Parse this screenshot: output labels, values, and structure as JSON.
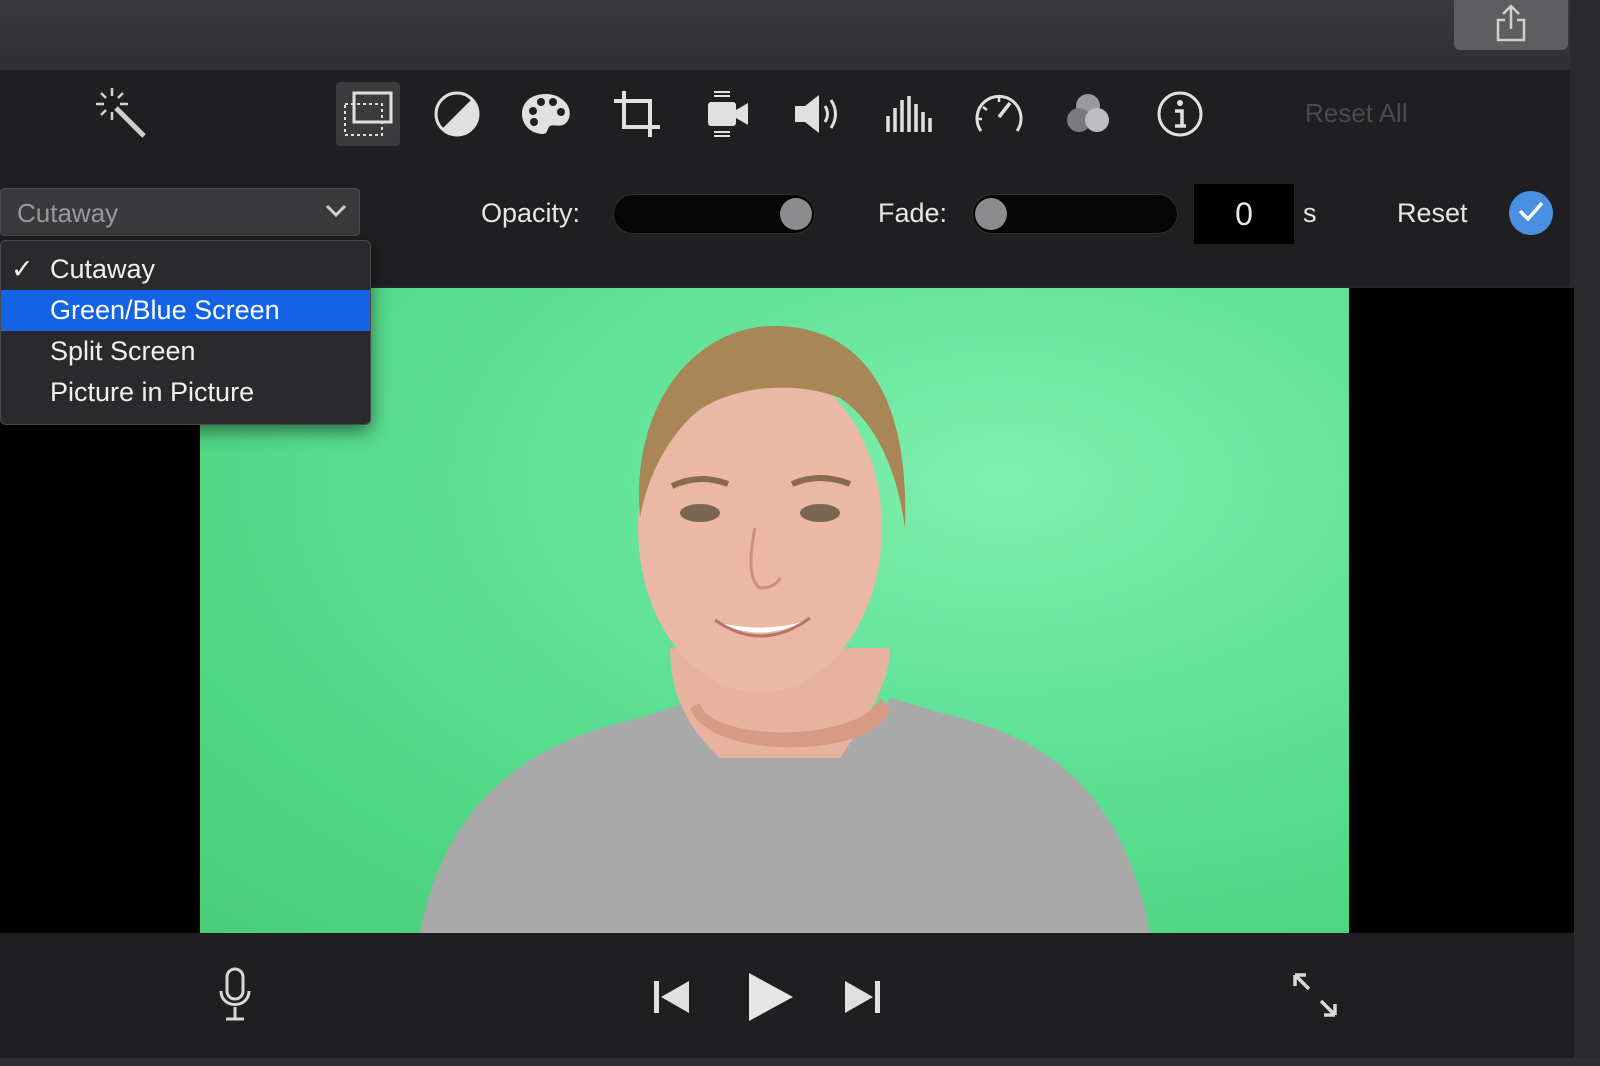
{
  "toolbar": {
    "reset_all_label": "Reset All",
    "icons": [
      "magic-wand-icon",
      "video-overlay-icon",
      "color-balance-icon",
      "color-palette-icon",
      "crop-icon",
      "stabilization-icon",
      "volume-icon",
      "equalizer-icon",
      "speed-icon",
      "clip-filter-icon",
      "info-icon"
    ],
    "active_tool": "video-overlay-icon"
  },
  "overlay": {
    "dropdown_value": "Cutaway",
    "options": [
      "Cutaway",
      "Green/Blue Screen",
      "Split Screen",
      "Picture in Picture"
    ],
    "checked_option": "Cutaway",
    "highlighted_option": "Green/Blue Screen",
    "opacity_label": "Opacity:",
    "opacity_value": 1.0,
    "fade_label": "Fade:",
    "fade_value": "0",
    "fade_unit": "s",
    "reset_label": "Reset"
  },
  "colors": {
    "accent": "#1462e6",
    "confirm": "#4a90e2",
    "greenscreen": "#5ddc92"
  },
  "playback": {
    "icons": [
      "microphone-icon",
      "skip-back-icon",
      "play-icon",
      "skip-forward-icon",
      "fullscreen-icon"
    ]
  }
}
